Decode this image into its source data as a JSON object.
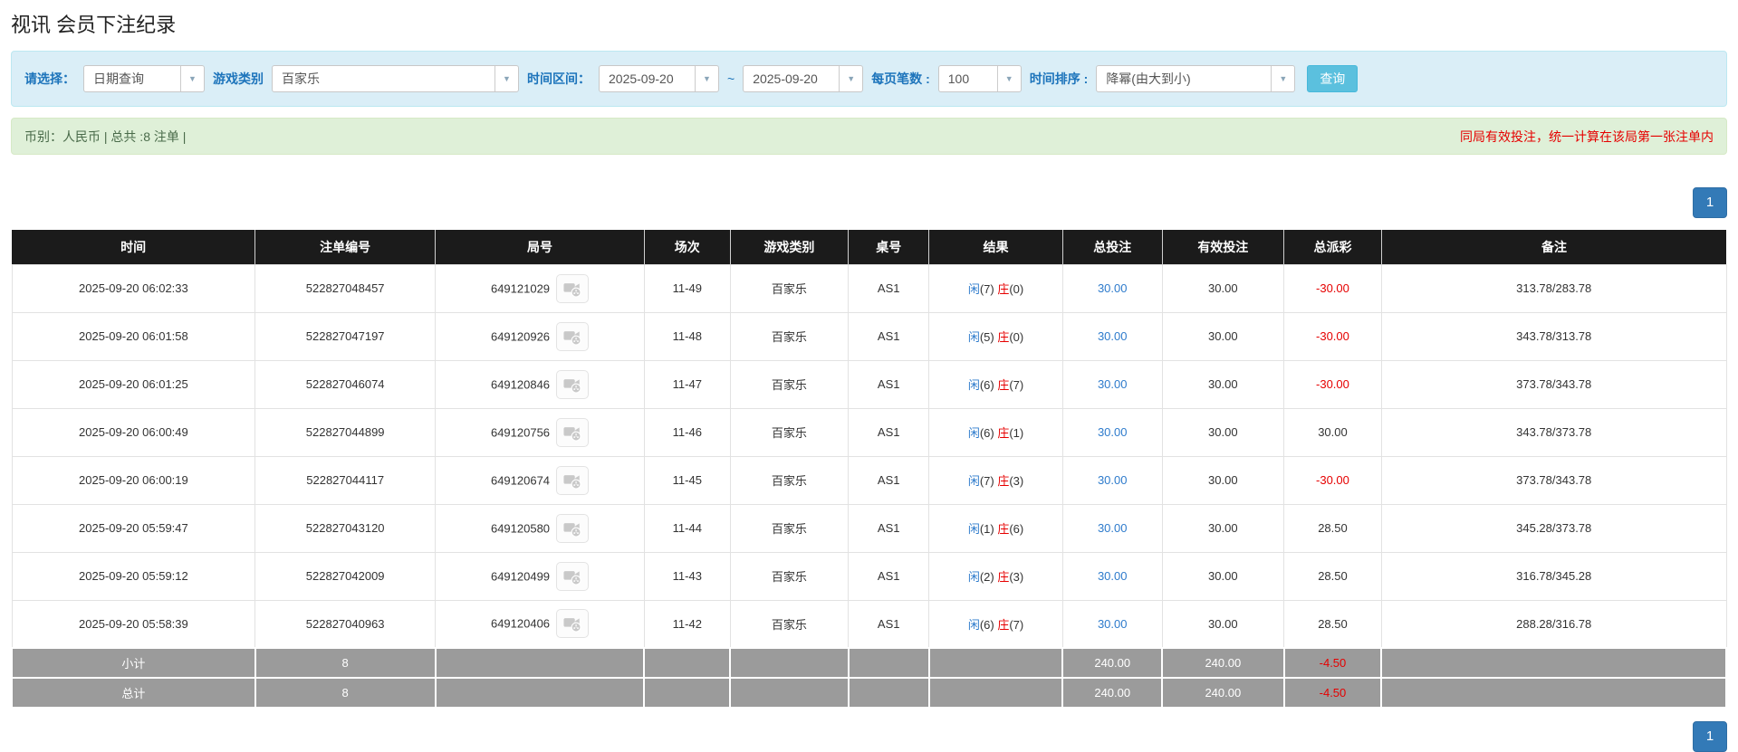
{
  "page": {
    "title": "视讯 会员下注纪录"
  },
  "filters": {
    "query_type_label": "请选择：",
    "query_type_value": "日期查询",
    "game_label": "游戏类别",
    "game_value": "百家乐",
    "range_label": "时间区间：",
    "date_from": "2025-09-20",
    "tilde": "~",
    "date_to": "2025-09-20",
    "per_page_label": "每页笔数 :",
    "per_page_value": "100",
    "sort_label": "时间排序 :",
    "sort_value": "降幂(由大到小)",
    "search_button": "查询",
    "chevron": "▼"
  },
  "summary": {
    "left": "币别：人民币 | 总共 :8 注单 |",
    "right": "同局有效投注，统一计算在该局第一张注单内"
  },
  "pagination": {
    "page": "1"
  },
  "table": {
    "headers": [
      "时间",
      "注单编号",
      "局号",
      "场次",
      "游戏类别",
      "桌号",
      "结果",
      "总投注",
      "有效投注",
      "总派彩",
      "备注"
    ],
    "col_widths": [
      "14.2%",
      "10.5%",
      "12.2%",
      "5.0%",
      "6.9%",
      "4.7%",
      "7.8%",
      "5.8%",
      "7.1%",
      "5.7%",
      "20.1%"
    ],
    "result_labels": {
      "player": "闲",
      "banker": "庄"
    },
    "rows": [
      {
        "time": "2025-09-20 06:02:33",
        "bet_id": "522827048457",
        "round_id": "649121029",
        "session": "11-49",
        "game": "百家乐",
        "table_no": "AS1",
        "player": "7",
        "banker": "0",
        "total_bet": "30.00",
        "valid_bet": "30.00",
        "payout": "-30.00",
        "remark": "313.78/283.78"
      },
      {
        "time": "2025-09-20 06:01:58",
        "bet_id": "522827047197",
        "round_id": "649120926",
        "session": "11-48",
        "game": "百家乐",
        "table_no": "AS1",
        "player": "5",
        "banker": "0",
        "total_bet": "30.00",
        "valid_bet": "30.00",
        "payout": "-30.00",
        "remark": "343.78/313.78"
      },
      {
        "time": "2025-09-20 06:01:25",
        "bet_id": "522827046074",
        "round_id": "649120846",
        "session": "11-47",
        "game": "百家乐",
        "table_no": "AS1",
        "player": "6",
        "banker": "7",
        "total_bet": "30.00",
        "valid_bet": "30.00",
        "payout": "-30.00",
        "remark": "373.78/343.78"
      },
      {
        "time": "2025-09-20 06:00:49",
        "bet_id": "522827044899",
        "round_id": "649120756",
        "session": "11-46",
        "game": "百家乐",
        "table_no": "AS1",
        "player": "6",
        "banker": "1",
        "total_bet": "30.00",
        "valid_bet": "30.00",
        "payout": "30.00",
        "remark": "343.78/373.78"
      },
      {
        "time": "2025-09-20 06:00:19",
        "bet_id": "522827044117",
        "round_id": "649120674",
        "session": "11-45",
        "game": "百家乐",
        "table_no": "AS1",
        "player": "7",
        "banker": "3",
        "total_bet": "30.00",
        "valid_bet": "30.00",
        "payout": "-30.00",
        "remark": "373.78/343.78"
      },
      {
        "time": "2025-09-20 05:59:47",
        "bet_id": "522827043120",
        "round_id": "649120580",
        "session": "11-44",
        "game": "百家乐",
        "table_no": "AS1",
        "player": "1",
        "banker": "6",
        "total_bet": "30.00",
        "valid_bet": "30.00",
        "payout": "28.50",
        "remark": "345.28/373.78"
      },
      {
        "time": "2025-09-20 05:59:12",
        "bet_id": "522827042009",
        "round_id": "649120499",
        "session": "11-43",
        "game": "百家乐",
        "table_no": "AS1",
        "player": "2",
        "banker": "3",
        "total_bet": "30.00",
        "valid_bet": "30.00",
        "payout": "28.50",
        "remark": "316.78/345.28"
      },
      {
        "time": "2025-09-20 05:58:39",
        "bet_id": "522827040963",
        "round_id": "649120406",
        "session": "11-42",
        "game": "百家乐",
        "table_no": "AS1",
        "player": "6",
        "banker": "7",
        "total_bet": "30.00",
        "valid_bet": "30.00",
        "payout": "28.50",
        "remark": "288.28/316.78"
      }
    ],
    "footer": [
      {
        "label": "小计",
        "count": "8",
        "total_bet": "240.00",
        "valid_bet": "240.00",
        "payout": "-4.50"
      },
      {
        "label": "总计",
        "count": "8",
        "total_bet": "240.00",
        "valid_bet": "240.00",
        "payout": "-4.50"
      }
    ]
  },
  "colors": {
    "accent_blue": "#2e7bcc",
    "red": "#e60000",
    "header_bg": "#1b1b1b",
    "footer_bg": "#9b9b9b",
    "filter_bg": "#daeef7",
    "summary_bg": "#dff0d8",
    "button_bg": "#5bc0de",
    "pagination_bg": "#337ab7"
  }
}
